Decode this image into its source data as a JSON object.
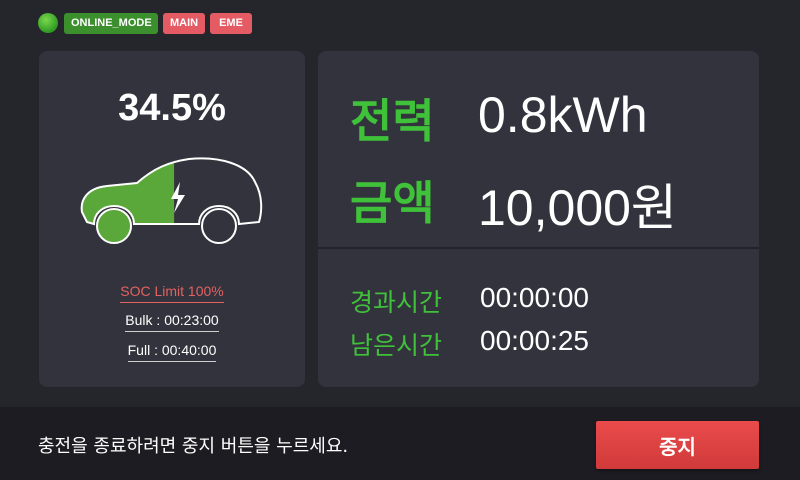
{
  "status": {
    "mode": "ONLINE_MODE",
    "badges": [
      "MAIN",
      "EME"
    ],
    "indicator_color": "#3fa92c"
  },
  "battery": {
    "soc_text": "34.5%",
    "soc_fraction": 0.345,
    "soc_limit": "SOC Limit 100%",
    "bulk": "Bulk : 00:23:00",
    "full": "Full : 00:40:00",
    "icons": [
      "car-icon",
      "lightning-bolt-icon"
    ]
  },
  "summary": {
    "power_label": "전력",
    "power_value": "0.8kWh",
    "amount_label": "금액",
    "amount_value": "10,000원"
  },
  "times": {
    "elapsed_label": "경과시간",
    "elapsed_value": "00:00:00",
    "remaining_label": "남은시간",
    "remaining_value": "00:00:25"
  },
  "footer": {
    "instruction": "충전을 종료하려면 중지 버튼을 누르세요.",
    "stop_label": "중지"
  },
  "colors": {
    "accent_green": "#3fc23a",
    "alert_red": "#e45b63",
    "button_red": "#e04444",
    "panel_bg": "#33333d",
    "page_bg": "#25252c"
  }
}
